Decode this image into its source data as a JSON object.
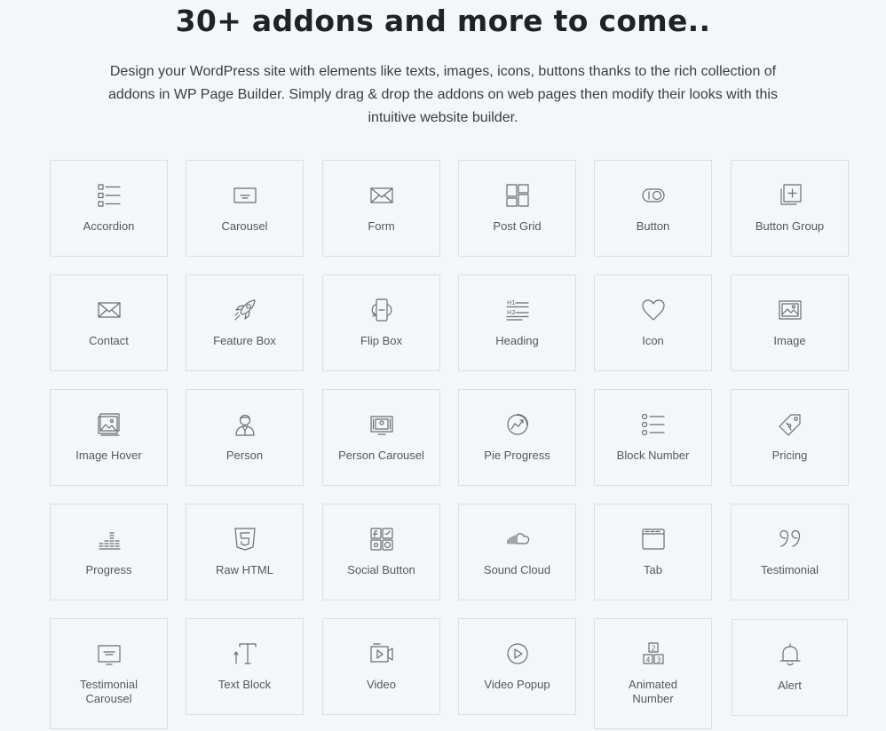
{
  "header": {
    "title": "30+ addons and more to come..",
    "description": "Design your WordPress site with elements like texts, images, icons, buttons thanks to the rich collection of addons in WP Page Builder. Simply drag & drop the addons on web pages then modify their looks with this intuitive website builder."
  },
  "addons": [
    {
      "label": "Accordion",
      "icon": "accordion-icon"
    },
    {
      "label": "Carousel",
      "icon": "carousel-icon"
    },
    {
      "label": "Form",
      "icon": "form-icon"
    },
    {
      "label": "Post Grid",
      "icon": "post-grid-icon"
    },
    {
      "label": "Button",
      "icon": "button-icon"
    },
    {
      "label": "Button Group",
      "icon": "button-group-icon"
    },
    {
      "label": "Contact",
      "icon": "contact-icon"
    },
    {
      "label": "Feature Box",
      "icon": "rocket-icon"
    },
    {
      "label": "Flip Box",
      "icon": "flip-box-icon"
    },
    {
      "label": "Heading",
      "icon": "heading-icon"
    },
    {
      "label": "Icon",
      "icon": "heart-icon"
    },
    {
      "label": "Image",
      "icon": "image-icon"
    },
    {
      "label": "Image Hover",
      "icon": "image-hover-icon"
    },
    {
      "label": "Person",
      "icon": "person-icon"
    },
    {
      "label": "Person Carousel",
      "icon": "person-carousel-icon"
    },
    {
      "label": "Pie Progress",
      "icon": "pie-progress-icon"
    },
    {
      "label": "Block Number",
      "icon": "block-number-icon"
    },
    {
      "label": "Pricing",
      "icon": "price-tag-icon"
    },
    {
      "label": "Progress",
      "icon": "progress-icon"
    },
    {
      "label": "Raw HTML",
      "icon": "html5-icon"
    },
    {
      "label": "Social Button",
      "icon": "social-button-icon"
    },
    {
      "label": "Sound Cloud",
      "icon": "sound-cloud-icon"
    },
    {
      "label": "Tab",
      "icon": "tab-icon"
    },
    {
      "label": "Testimonial",
      "icon": "quote-icon"
    },
    {
      "label": "Testimonial\nCarousel",
      "icon": "testimonial-carousel-icon"
    },
    {
      "label": "Text Block",
      "icon": "text-block-icon"
    },
    {
      "label": "Video",
      "icon": "video-icon"
    },
    {
      "label": "Video Popup",
      "icon": "video-popup-icon"
    },
    {
      "label": "Animated\nNumber",
      "icon": "animated-number-icon"
    },
    {
      "label": "Alert",
      "icon": "bell-icon"
    }
  ]
}
